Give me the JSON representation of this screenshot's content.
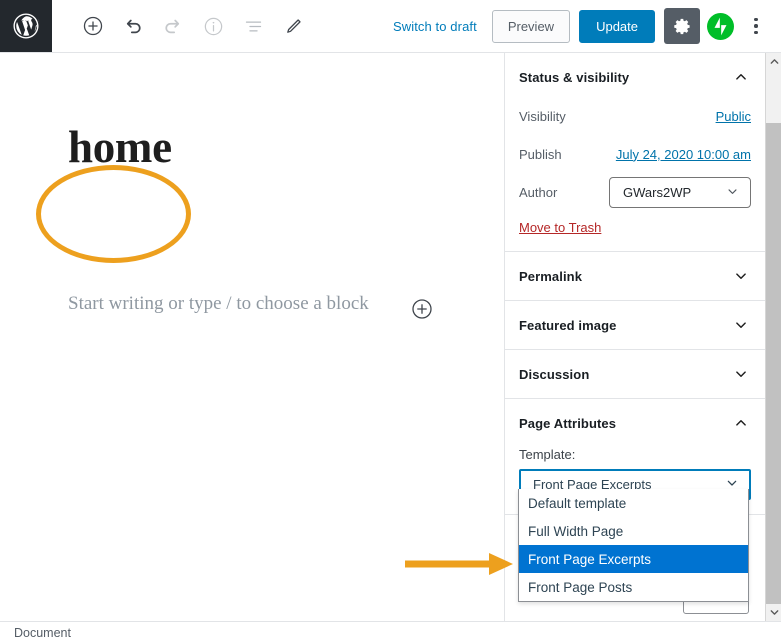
{
  "topbar": {
    "logo_icon": "wordpress-logo-icon",
    "tools": [
      {
        "name": "add-block-button",
        "icon": "plus-circle-icon",
        "disabled": false
      },
      {
        "name": "undo-button",
        "icon": "undo-arrow-icon",
        "disabled": false
      },
      {
        "name": "redo-button",
        "icon": "redo-arrow-icon",
        "disabled": true
      },
      {
        "name": "details-button",
        "icon": "info-circle-icon",
        "disabled": true
      },
      {
        "name": "list-view-button",
        "icon": "list-view-icon",
        "disabled": false
      },
      {
        "name": "edit-mode-button",
        "icon": "pencil-icon",
        "disabled": false
      }
    ],
    "switch_to_draft_label": "Switch to draft",
    "preview_label": "Preview",
    "update_label": "Update",
    "settings_icon": "gear-icon",
    "jetpack_icon": "jetpack-icon",
    "more_options_icon": "kebab-menu-icon"
  },
  "editor": {
    "post_title": "home",
    "paragraph_placeholder": "Start writing or type / to choose a block",
    "appender_icon": "plus-circle-icon"
  },
  "annotations": {
    "ellipse_target": "home",
    "arrow_target": "Front Page Excerpts",
    "color": "#eda01e"
  },
  "sidebar": {
    "panels": [
      {
        "name": "status-and-visibility",
        "title": "Status & visibility",
        "expanded": true,
        "chevron_icon": "chevron-up-icon",
        "rows": [
          {
            "label": "Visibility",
            "value": "Public",
            "type": "link"
          },
          {
            "label": "Publish",
            "value": "July 24, 2020 10:00 am",
            "type": "link"
          },
          {
            "label": "Author",
            "value": "GWars2WP",
            "type": "select"
          }
        ],
        "trash_label": "Move to Trash"
      },
      {
        "name": "permalink",
        "title": "Permalink",
        "expanded": false,
        "chevron_icon": "chevron-down-icon"
      },
      {
        "name": "featured-image",
        "title": "Featured image",
        "expanded": false,
        "chevron_icon": "chevron-down-icon"
      },
      {
        "name": "discussion",
        "title": "Discussion",
        "expanded": false,
        "chevron_icon": "chevron-down-icon"
      },
      {
        "name": "page-attributes",
        "title": "Page Attributes",
        "expanded": true,
        "chevron_icon": "chevron-up-icon",
        "template_label": "Template:",
        "template_value": "Front Page Excerpts",
        "template_chevron_icon": "chevron-down-icon"
      }
    ],
    "template_options": [
      {
        "label": "Default template",
        "selected": false
      },
      {
        "label": "Full Width Page",
        "selected": false
      },
      {
        "label": "Front Page Excerpts",
        "selected": true
      },
      {
        "label": "Front Page Posts",
        "selected": false
      }
    ]
  },
  "scrollbar": {
    "up_icon": "chevron-up-icon",
    "down_icon": "chevron-down-icon"
  },
  "statusbar": {
    "document_label": "Document"
  },
  "colors": {
    "brand_blue": "#007cba",
    "accent_orange": "#eda01e",
    "highlight_blue": "#0073d1",
    "trash_red": "#b52727",
    "jetpack_green": "#00be28",
    "dark_chrome": "#23282d"
  }
}
